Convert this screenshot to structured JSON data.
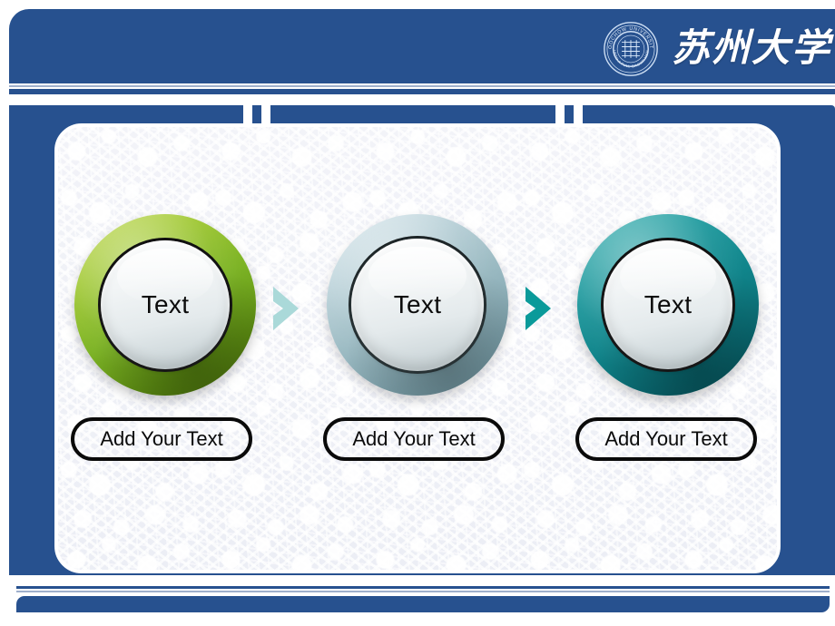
{
  "slide": {
    "header": {
      "logo_icon": "soochow-university-seal-icon",
      "seal_outer_text": "SOOCHOW UNIVERSITY",
      "seal_lower_text": "UNTO A FULL GROWN MAN",
      "university_name": "苏州大学"
    },
    "colors": {
      "brand_blue": "#27518f",
      "panel_bg": "#eef0f6",
      "green_ring": "#7cb325",
      "steel_ring": "#9dbcc4",
      "teal_ring": "#11868c",
      "arrow_light": "#aad9d9",
      "arrow_dark": "#0a9a9a",
      "outline_black": "#0a0a0a"
    },
    "nodes": [
      {
        "circle_label": "Text",
        "caption": "Add Your Text",
        "ring_style": "green"
      },
      {
        "circle_label": "Text",
        "caption": "Add Your Text",
        "ring_style": "steel"
      },
      {
        "circle_label": "Text",
        "caption": "Add Your Text",
        "ring_style": "teal"
      }
    ],
    "arrows": [
      {
        "icon": "chevron-right-icon",
        "color": "#aad9d9"
      },
      {
        "icon": "chevron-right-icon",
        "color": "#0a9a9a"
      }
    ],
    "decorations": {
      "notch_blocks": 5,
      "footer_rule": true
    }
  }
}
